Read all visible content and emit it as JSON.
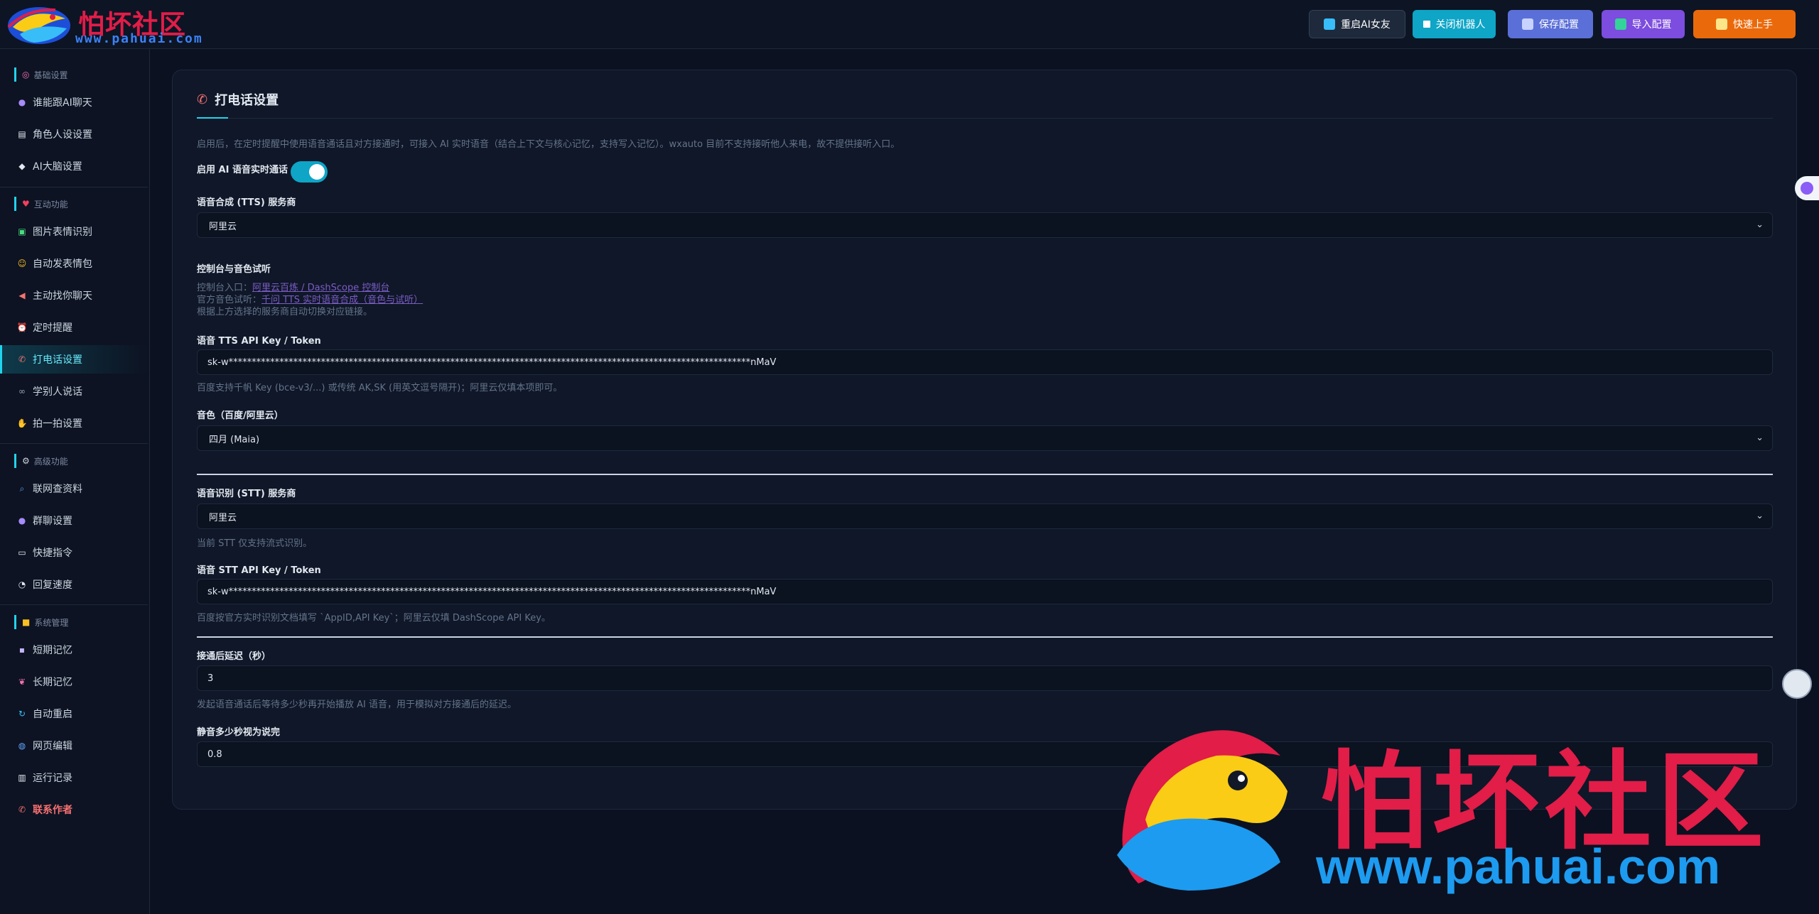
{
  "logo": {
    "name": "怕坏社区",
    "url": "www.pahuai.com"
  },
  "header": {
    "buttons": {
      "restart": "重启AI女友",
      "close_bot": "关闭机器人",
      "save": "保存配置",
      "import": "导入配置",
      "quick_start": "快速上手"
    }
  },
  "sidebar": {
    "sections": [
      {
        "title": "基础设置",
        "items": [
          "谁能跟AI聊天",
          "角色人设设置",
          "AI大脑设置"
        ]
      },
      {
        "title": "互动功能",
        "items": [
          "图片表情识别",
          "自动发表情包",
          "主动找你聊天",
          "定时提醒",
          "打电话设置",
          "学别人说话",
          "拍一拍设置"
        ]
      },
      {
        "title": "高级功能",
        "items": [
          "联网查资料",
          "群聊设置",
          "快捷指令",
          "回复速度"
        ]
      },
      {
        "title": "系统管理",
        "items": [
          "短期记忆",
          "长期记忆",
          "自动重启",
          "网页编辑",
          "运行记录",
          "联系作者"
        ]
      }
    ],
    "active_item": "打电话设置"
  },
  "main": {
    "title": "打电话设置",
    "intro": "启用后，在定时提醒中使用语音通话且对方接通时，可接入 AI 实时语音（结合上下文与核心记忆，支持写入记忆）。wxauto 目前不支持接听他人来电，故不提供接听入口。",
    "enable_label": "启用 AI 语音实时通话",
    "enable_value": true,
    "tts_provider_label": "语音合成 (TTS) 服务商",
    "tts_provider_value": "阿里云",
    "console_label": "控制台与音色试听",
    "console_entry_prefix": "控制台入口：",
    "console_entry_link": "阿里云百炼 / DashScope 控制台",
    "voice_trial_prefix": "官方音色试听：",
    "voice_trial_link": "千问 TTS 实时语音合成（音色与试听）",
    "console_note": "根据上方选择的服务商自动切换对应链接。",
    "tts_key_label": "语音 TTS API Key / Token",
    "tts_key_value": "sk-w*****************************************************************************************************************nMaV",
    "tts_key_help": "百度支持千帆 Key (bce-v3/...) 或传统 AK,SK (用英文逗号隔开)；阿里云仅填本项即可。",
    "voice_label": "音色（百度/阿里云）",
    "voice_value": "四月 (Maia)",
    "stt_provider_label": "语音识别 (STT) 服务商",
    "stt_provider_value": "阿里云",
    "stt_provider_help": "当前 STT 仅支持流式识别。",
    "stt_key_label": "语音 STT API Key / Token",
    "stt_key_value": "sk-w*****************************************************************************************************************nMaV",
    "stt_key_help": "百度按官方实时识别文档填写 `AppID,API Key`；阿里云仅填 DashScope API Key。",
    "delay_label": "接通后延迟（秒）",
    "delay_value": "3",
    "delay_help": "发起语音通话后等待多少秒再开始播放 AI 语音，用于模拟对方接通后的延迟。",
    "silence_label": "静音多少秒视为说完",
    "silence_value": "0.8"
  },
  "icons": {
    "phone": "phone-icon",
    "ai_float": "ai-assistant-icon",
    "avatar": "avatar"
  },
  "colors": {
    "accent": "#22d3ee",
    "brand_red": "#e11d48",
    "brand_blue": "#1d9bf0",
    "save": "#5b6fd8",
    "import": "#7c4dde",
    "quick": "#ea6a0b",
    "close": "#0ea5c6"
  }
}
